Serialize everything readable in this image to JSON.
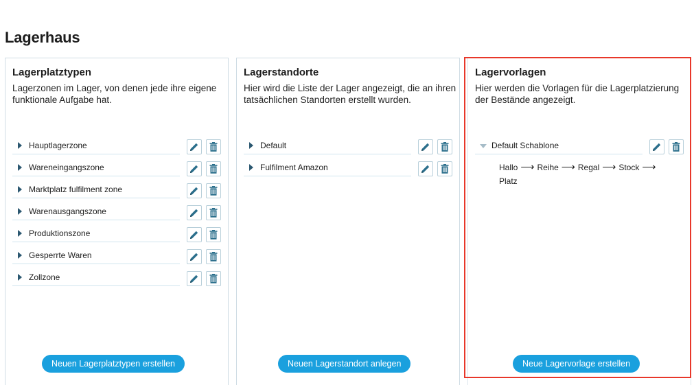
{
  "page": {
    "title": "Lagerhaus"
  },
  "cards": [
    {
      "title": "Lagerplatztypen",
      "description": "Lagerzonen im Lager, von denen jede ihre eigene funktionale Aufgabe hat.",
      "items": [
        "Hauptlagerzone",
        "Wareneingangszone",
        "Marktplatz fulfilment zone",
        "Warenausgangszone",
        "Produktionszone",
        "Gesperrte Waren",
        "Zollzone"
      ],
      "create_label": "Neuen Lagerplatztypen erstellen"
    },
    {
      "title": "Lagerstandorte",
      "description": "Hier wird die Liste der Lager angezeigt, die an ihren tatsächlichen Standorten erstellt wurden.",
      "items": [
        "Default",
        "Fulfilment Amazon"
      ],
      "create_label": "Neuen Lagerstandort anlegen"
    },
    {
      "title": "Lagervorlagen",
      "description": "Hier werden die Vorlagen für die Lagerplatzierung der Bestände angezeigt.",
      "items": [
        "Default Schablone"
      ],
      "template_path": [
        "Hallo",
        "Reihe",
        "Regal",
        "Stock",
        "Platz"
      ],
      "create_label": "Neue Lagervorlage erstellen"
    }
  ],
  "icons": {
    "edit": "pencil-icon",
    "delete": "trash-icon",
    "expand": "caret-right-icon",
    "collapse": "caret-down-icon"
  },
  "colors": {
    "accent": "#1aa0de",
    "icon": "#2b6f8c",
    "highlight": "#e8372a"
  }
}
